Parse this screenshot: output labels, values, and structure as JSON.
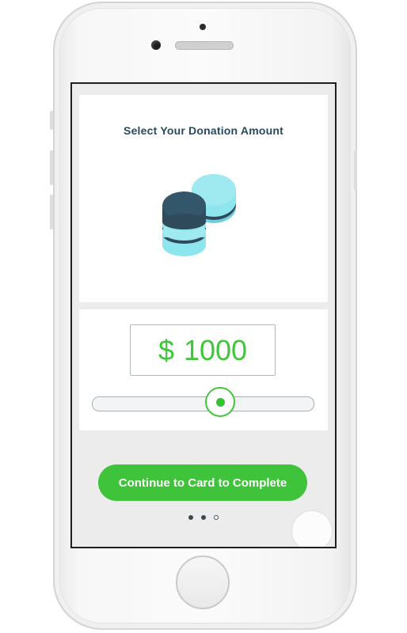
{
  "donation": {
    "title": "Select Your Donation Amount",
    "currency_symbol": "$",
    "amount": "1000",
    "slider_fraction": 0.58
  },
  "cta": {
    "label": "Continue to Card to Complete"
  },
  "pager": {
    "total": 3,
    "current": 2
  },
  "colors": {
    "accent": "#3ec33a",
    "title": "#274a5e",
    "coin_dark": "#2f4a5b",
    "coin_light": "#8de5ee"
  },
  "icons": {
    "illustration": "coin-stack-icon"
  }
}
